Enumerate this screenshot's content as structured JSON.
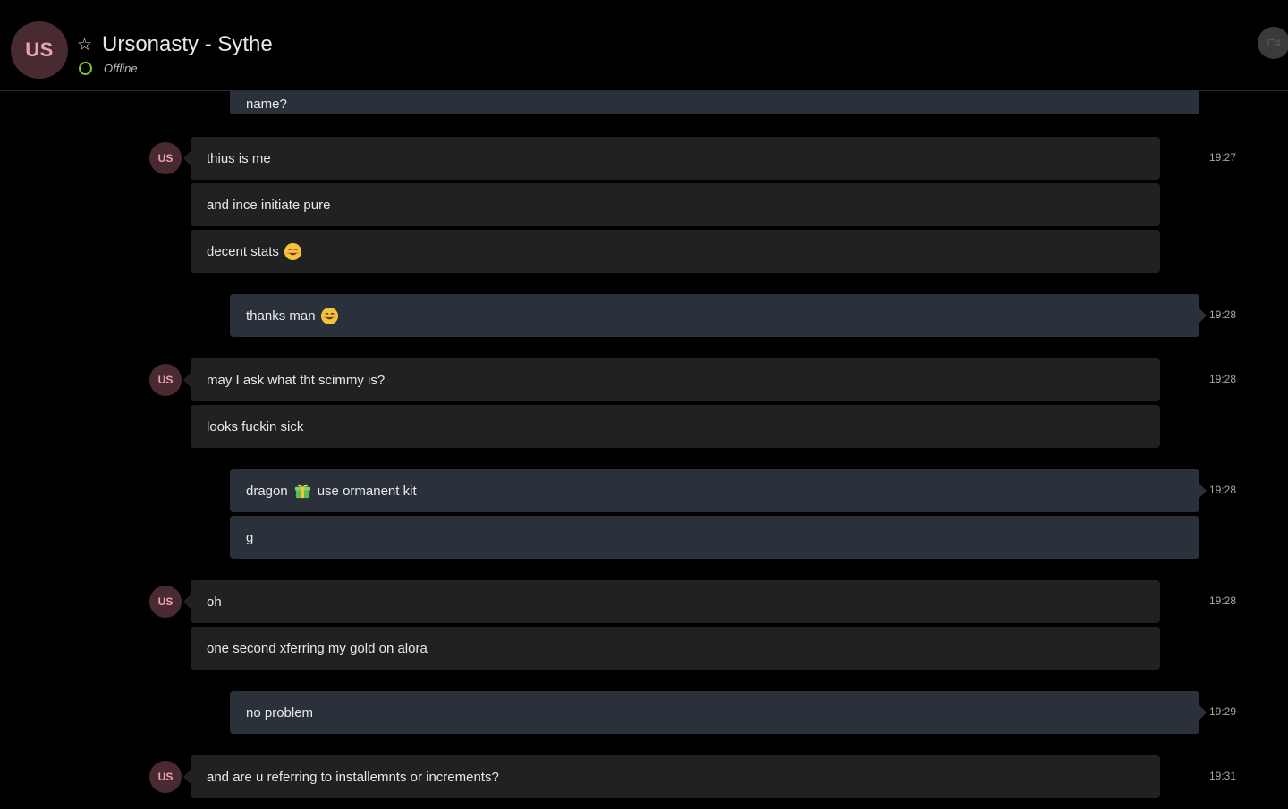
{
  "header": {
    "avatar_initials": "US",
    "title": "Ursonasty - Sythe",
    "status": "Offline"
  },
  "messages": [
    {
      "dir": "out",
      "text": "name?"
    },
    {
      "dir": "in",
      "text": "thius is me",
      "time": "19:27"
    },
    {
      "dir": "in",
      "text": "and ince initiate pure"
    },
    {
      "dir": "in",
      "text": "decent stats",
      "emoji": "smiling-face-emoji"
    },
    {
      "dir": "out",
      "text": "thanks man",
      "emoji": "smiling-face-emoji",
      "time": "19:28"
    },
    {
      "dir": "in",
      "text": "may I ask what tht scimmy is?",
      "time": "19:28"
    },
    {
      "dir": "in",
      "text": "looks fuckin sick"
    },
    {
      "dir": "out",
      "text_before": "dragon",
      "emoji": "wrapped-gift-emoji",
      "text_after": "use ormanent kit",
      "time": "19:28"
    },
    {
      "dir": "out",
      "text": "g"
    },
    {
      "dir": "in",
      "text": "oh",
      "time": "19:28"
    },
    {
      "dir": "in",
      "text": "one second xferring my gold on alora"
    },
    {
      "dir": "out",
      "text": "no problem",
      "time": "19:29"
    },
    {
      "dir": "in",
      "text": "and are u referring to installemnts or increments?",
      "time": "19:31"
    }
  ],
  "message_avatar_initials": "US",
  "colors": {
    "background": "#000000",
    "incoming_bubble": "#212121",
    "outgoing_bubble": "#2b313b",
    "avatar_bg": "#4a2a31",
    "avatar_text": "#e8a3b0",
    "online_ring": "#7fc633"
  }
}
